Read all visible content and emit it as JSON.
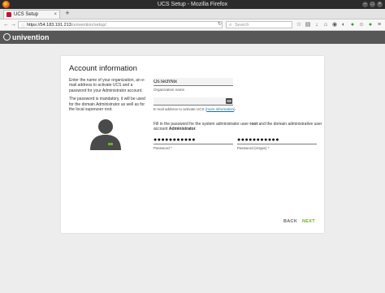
{
  "window": {
    "title": "UCS Setup - Mozilla Firefox"
  },
  "tab": {
    "label": "UCS Setup",
    "close": "×",
    "new_tab": "+"
  },
  "navbar": {
    "url_host": "https://54.183.191.213",
    "url_path": "/univention/setup/",
    "search_placeholder": "Search"
  },
  "app": {
    "logo_text": "univention"
  },
  "form": {
    "title": "Account information",
    "intro_1": "Enter the name of your organization, an e-mail address to activate UCS and a password for your Administrator account.",
    "intro_2": "The password is mandatory, it will be used for the domain Administrator as well as for the local superuser root.",
    "org_value": "OsTechNix",
    "org_label": "Organization name",
    "email_value": "",
    "email_label": "E-mail address to activate UCS",
    "email_link": "more information",
    "password_hint_pre": "Fill in the password for the system administrator user ",
    "password_hint_root": "root",
    "password_hint_mid": " and the domain administrative user account ",
    "password_hint_admin": "Administrator",
    "password_hint_end": ".",
    "password_value": "●●●●●●●●●●●",
    "password_label": "Password *",
    "password_retype_value": "●●●●●●●●●●●",
    "password_retype_label": "Password (retype) *",
    "back_label": "BACK",
    "next_label": "NEXT"
  },
  "colors": {
    "accent_green": "#6ab023",
    "appbar": "#575757",
    "univention_red": "#c8102e"
  }
}
